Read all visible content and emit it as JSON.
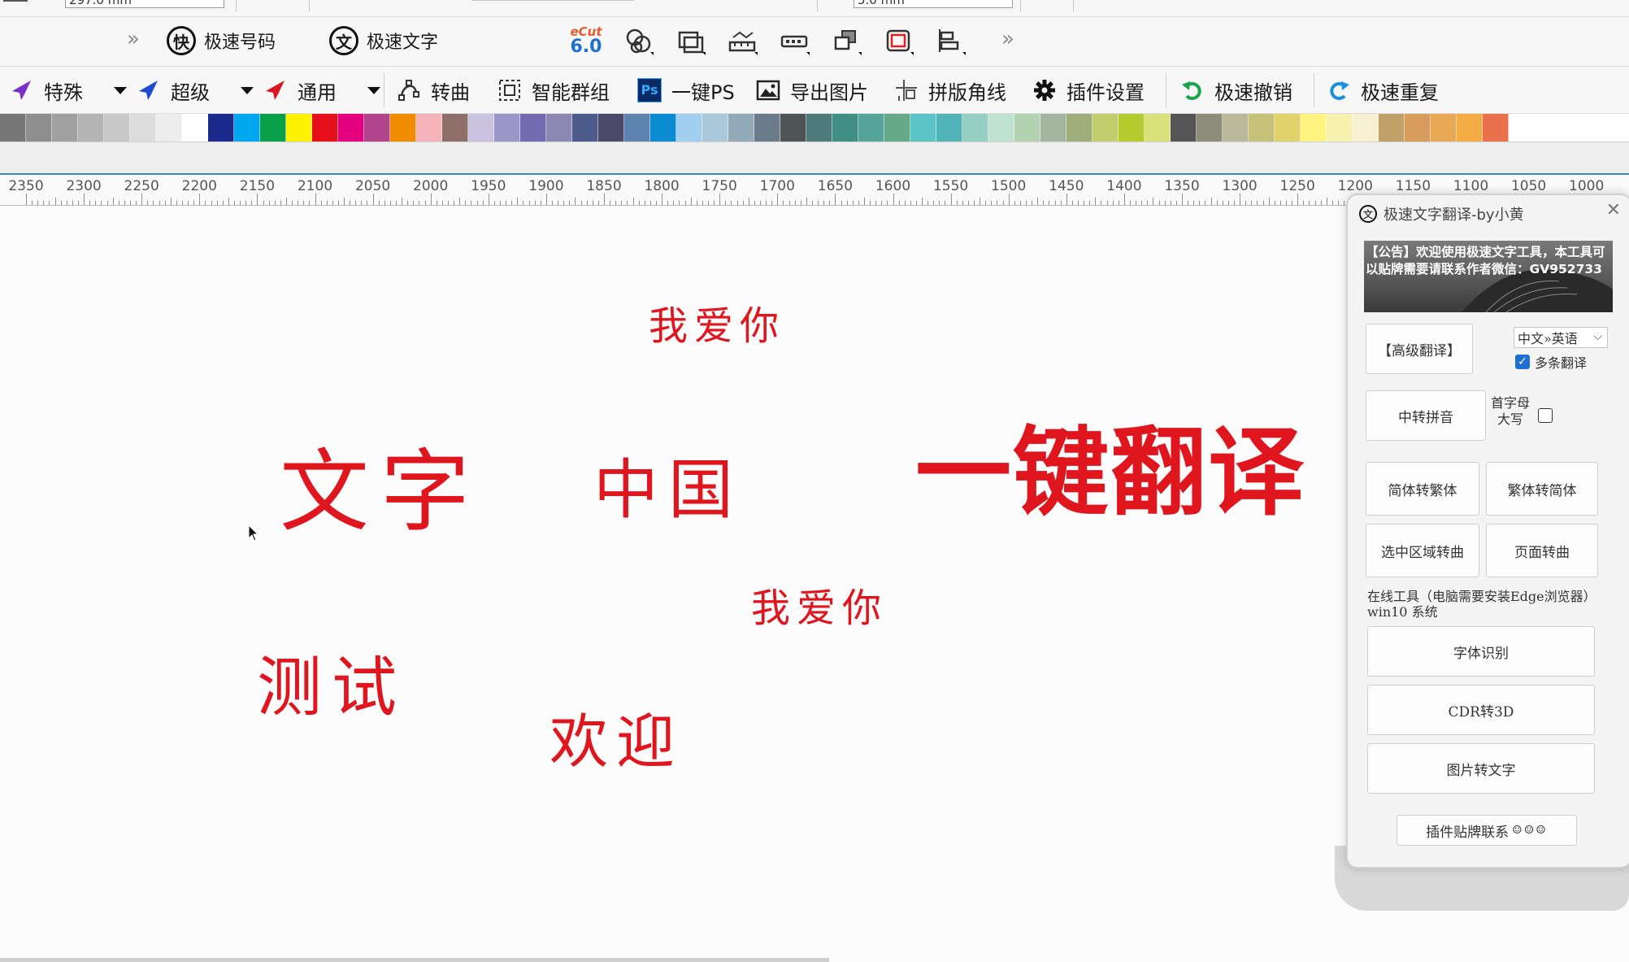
{
  "top_strip": {
    "field1": "297.0 mm",
    "field2": "5.0 mm"
  },
  "toolbar1": {
    "chevron_left": "»",
    "btn_fast_number": {
      "icon_char": "快",
      "label": "极速号码"
    },
    "btn_fast_text": {
      "icon_char": "文",
      "label": "极速文字"
    },
    "ecut": {
      "line1": "eCut",
      "line2": "6.0"
    },
    "chevron_right": "»"
  },
  "toolbar2": {
    "special": "特殊",
    "super": "超级",
    "general": "通用",
    "to_curve": "转曲",
    "smart_group": "智能群组",
    "ps_icon": "Ps",
    "one_key_ps": "一键PS",
    "export_image": "导出图片",
    "imposition_corners": "拼版角线",
    "plugin_settings": "插件设置",
    "fast_undo": "极速撤销",
    "fast_redo": "极速重复"
  },
  "palette": {
    "colors": [
      "#777777",
      "#8e8e8e",
      "#a0a0a0",
      "#b4b4b4",
      "#c8c8c8",
      "#dcdcdc",
      "#ededed",
      "#ffffff",
      "#1b2a8c",
      "#00a6ee",
      "#0aa04a",
      "#fff200",
      "#e5101a",
      "#e4007f",
      "#b0448d",
      "#f08c00",
      "#f4b3b8",
      "#8e6f6a",
      "#c9c3e0",
      "#9a96c8",
      "#736aaf",
      "#8d88b3",
      "#4d5b8c",
      "#4b4a6b",
      "#5d84b0",
      "#0b8bd2",
      "#a2cff0",
      "#a9c9db",
      "#92a9b7",
      "#6c7b8a",
      "#4e5456",
      "#4d7b7c",
      "#3f8f85",
      "#56a59a",
      "#64aa89",
      "#5bc4c9",
      "#4fb3b8",
      "#94cfc1",
      "#bfe3d0",
      "#b3d2b1",
      "#a3b59f",
      "#9dae7a",
      "#c2cd6d",
      "#b5cc2e",
      "#d9e17a",
      "#555555",
      "#8e8c7b",
      "#b9b89a",
      "#c6c178",
      "#e1d26a",
      "#fff480",
      "#f8f2b0",
      "#f6efd2",
      "#c2a169",
      "#d89c5c",
      "#e7a954",
      "#f3ab43",
      "#e9724d"
    ]
  },
  "ruler": {
    "labels": [
      "2350",
      "2300",
      "2250",
      "2200",
      "2150",
      "2100",
      "2050",
      "2000",
      "1950",
      "1900",
      "1850",
      "1800",
      "1750",
      "1700",
      "1650",
      "1600",
      "1550",
      "1500",
      "1450",
      "1400",
      "1350",
      "1300",
      "1250",
      "1200",
      "1150",
      "1100",
      "1050",
      "1000"
    ]
  },
  "canvas_texts": {
    "text1": "我爱你",
    "text2": "文字",
    "text3": "中国",
    "text4": "一键翻译",
    "text5": "我爱你",
    "text6": "测试",
    "text7": "欢迎"
  },
  "panel": {
    "title": "极速文字翻译-by小黄",
    "close": "✕",
    "announcement": "【公告】欢迎使用极速文字工具，本工具可以贴牌需要请联系作者微信：GV952733",
    "advanced_translate": "【高级翻译】",
    "language_select": "中文»英语",
    "multi_translate_label": "多条翻译",
    "to_pinyin": "中转拼音",
    "capitalize_label": "首字母大写",
    "s2t": "简体转繁体",
    "t2s": "繁体转简体",
    "selection_to_curve": "选中区域转曲",
    "page_to_curve": "页面转曲",
    "online_tools_note": "在线工具（电脑需要安装Edge浏览器）win10 系统",
    "font_identify": "字体识别",
    "cdr_to_3d": "CDR转3D",
    "image_to_text": "图片转文字",
    "oem_contact": "插件贴牌联系"
  }
}
